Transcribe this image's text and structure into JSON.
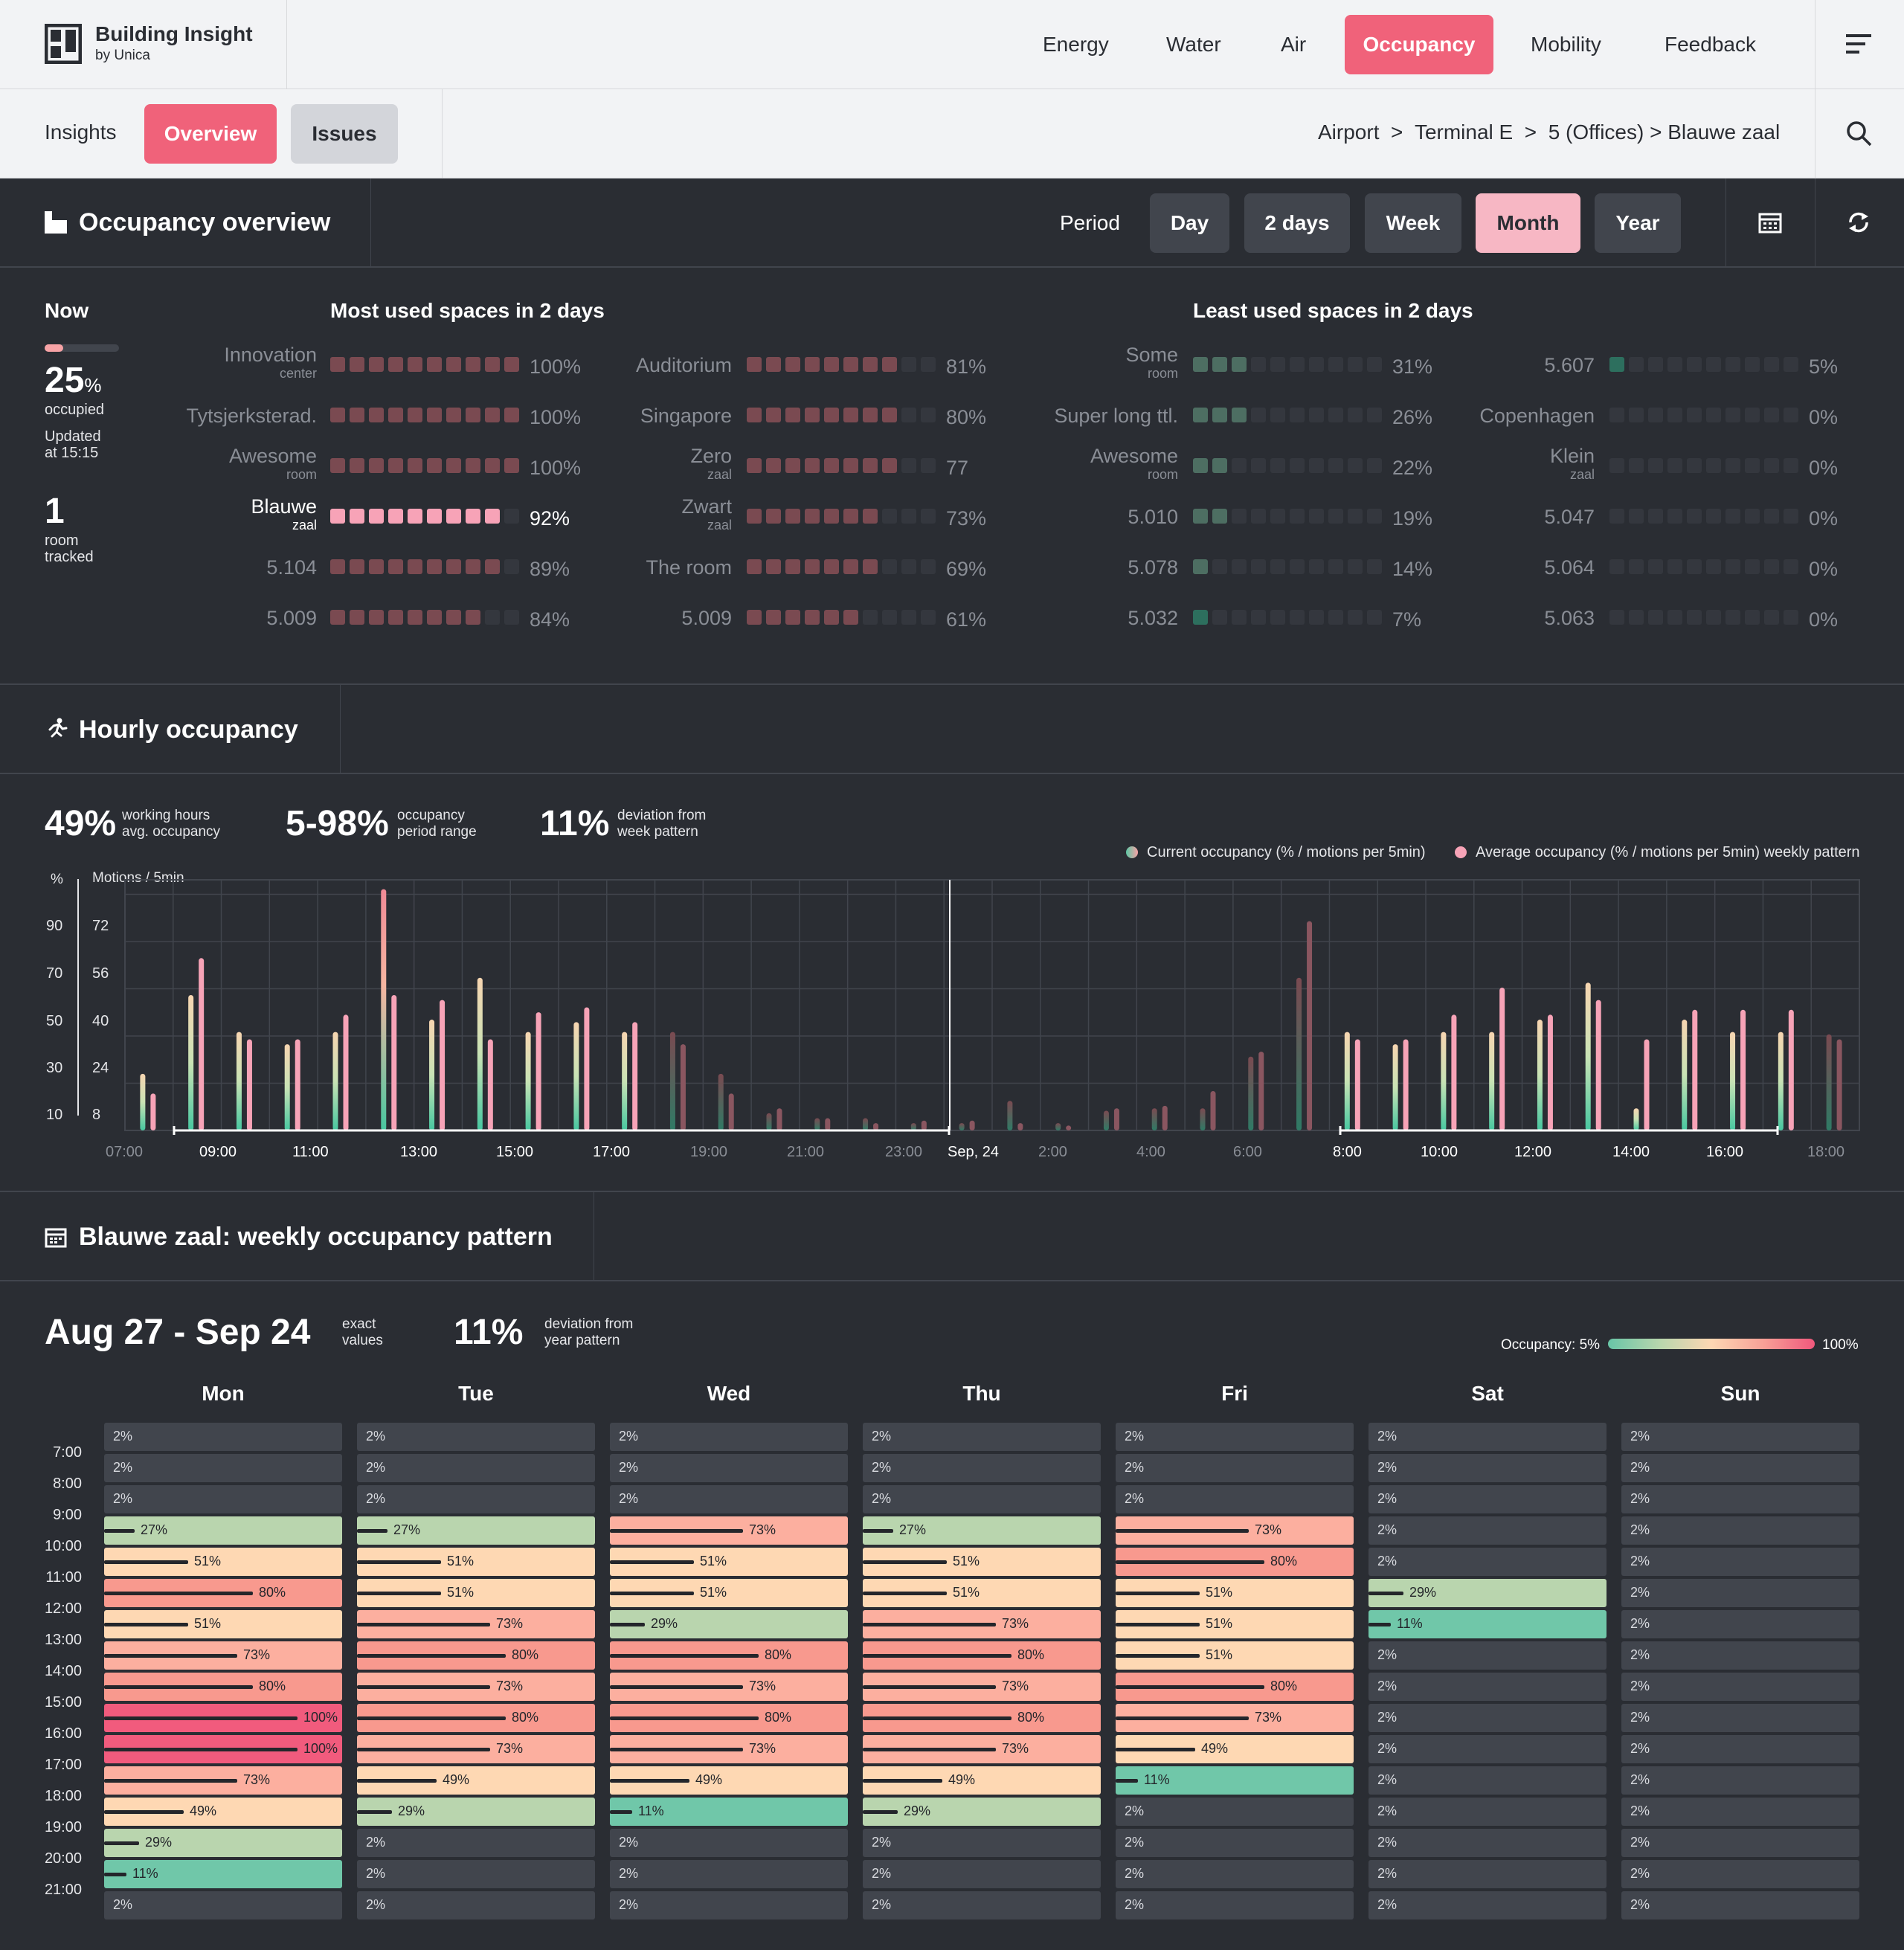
{
  "app": {
    "name": "Building Insight",
    "by": "by Unica"
  },
  "nav": {
    "items": [
      "Energy",
      "Water",
      "Air",
      "Occupancy",
      "Mobility",
      "Feedback"
    ],
    "active": "Occupancy"
  },
  "subnav": {
    "insights": "Insights",
    "overview": "Overview",
    "issues": "Issues"
  },
  "breadcrumb": {
    "l1": "Airport",
    "s1": ">",
    "l2": "Terminal E",
    "s2": ">",
    "l3": "5 (Offices)",
    "s3": ">",
    "l4": "Blauwe zaal"
  },
  "overview": {
    "title": "Occupancy overview",
    "period_label": "Period",
    "periods": [
      "Day",
      "2 days",
      "Week",
      "Month",
      "Year"
    ],
    "active_period": "Month",
    "now": {
      "label": "Now",
      "pct_num": "25",
      "pct_sign": "%",
      "occupied": "occupied",
      "updated": "Updated",
      "at": "at 15:15",
      "rooms": "1",
      "room": "room",
      "tracked": "tracked",
      "level": 0.25
    },
    "most_title": "Most used spaces in 2 days",
    "least_title": "Least used spaces in 2 days",
    "most_col1": [
      {
        "name": "Innovation",
        "sub": "center",
        "pct": "100%",
        "v": 100
      },
      {
        "name": "Tytsjerksterad.",
        "sub": "",
        "pct": "100%",
        "v": 100
      },
      {
        "name": "Awesome",
        "sub": "room",
        "pct": "100%",
        "v": 100
      },
      {
        "name": "Blauwe",
        "sub": "zaal",
        "pct": "92%",
        "v": 92,
        "hl": true
      },
      {
        "name": "5.104",
        "sub": "",
        "pct": "89%",
        "v": 89
      },
      {
        "name": "5.009",
        "sub": "",
        "pct": "84%",
        "v": 84
      }
    ],
    "most_col2": [
      {
        "name": "Auditorium",
        "sub": "",
        "pct": "81%",
        "v": 81
      },
      {
        "name": "Singapore",
        "sub": "",
        "pct": "80%",
        "v": 80
      },
      {
        "name": "Zero",
        "sub": "zaal",
        "pct": "77",
        "v": 77
      },
      {
        "name": "Zwart",
        "sub": "zaal",
        "pct": "73%",
        "v": 73
      },
      {
        "name": "The room",
        "sub": "",
        "pct": "69%",
        "v": 69
      },
      {
        "name": "5.009",
        "sub": "",
        "pct": "61%",
        "v": 61
      }
    ],
    "least_col1": [
      {
        "name": "Some",
        "sub": "room",
        "pct": "31%",
        "v": 31
      },
      {
        "name": "Super long ttl.",
        "sub": "",
        "pct": "26%",
        "v": 26
      },
      {
        "name": "Awesome",
        "sub": "room",
        "pct": "22%",
        "v": 22
      },
      {
        "name": "5.010",
        "sub": "",
        "pct": "19%",
        "v": 19
      },
      {
        "name": "5.078",
        "sub": "",
        "pct": "14%",
        "v": 14
      },
      {
        "name": "5.032",
        "sub": "",
        "pct": "7%",
        "v": 7
      }
    ],
    "least_col2": [
      {
        "name": "5.607",
        "sub": "",
        "pct": "5%",
        "v": 5
      },
      {
        "name": "Copenhagen",
        "sub": "",
        "pct": "0%",
        "v": 0
      },
      {
        "name": "Klein",
        "sub": "zaal",
        "pct": "0%",
        "v": 0
      },
      {
        "name": "5.047",
        "sub": "",
        "pct": "0%",
        "v": 0
      },
      {
        "name": "5.064",
        "sub": "",
        "pct": "0%",
        "v": 0
      },
      {
        "name": "5.063",
        "sub": "",
        "pct": "0%",
        "v": 0
      }
    ]
  },
  "hourly": {
    "title": "Hourly occupancy",
    "kpis": [
      {
        "value": "49%",
        "l1": "working hours",
        "l2": "avg. occupancy"
      },
      {
        "value": "5-98%",
        "l1": "occupancy",
        "l2": "period range"
      },
      {
        "value": "11%",
        "l1": "deviation from",
        "l2": "week pattern"
      }
    ],
    "legend_current": "Current occupancy (% / motions per 5min)",
    "legend_average": "Average occupancy (% / motions per 5min) weekly pattern",
    "y_unit": "%",
    "y2_unit": "Motions / 5min",
    "y_ticks": [
      "90",
      "70",
      "50",
      "30",
      "10"
    ],
    "y2_ticks": [
      "72",
      "56",
      "40",
      "24",
      "8"
    ],
    "x_ticks": [
      "07:00",
      "09:00",
      "11:00",
      "13:00",
      "15:00",
      "17:00",
      "19:00",
      "21:00",
      "23:00",
      "Sep, 24",
      "2:00",
      "4:00",
      "6:00",
      "8:00",
      "10:00",
      "12:00",
      "14:00",
      "16:00",
      "18:00"
    ],
    "colors": {
      "current": "#5cc7a5",
      "average": "#f7a3b7"
    }
  },
  "chart_data": {
    "type": "bar",
    "x_labels": [
      "07:00",
      "08:00",
      "09:00",
      "10:00",
      "11:00",
      "12:00",
      "13:00",
      "14:00",
      "15:00",
      "16:00",
      "17:00",
      "18:00",
      "19:00",
      "20:00",
      "21:00",
      "22:00",
      "23:00",
      "00:00",
      "01:00",
      "02:00",
      "03:00",
      "04:00",
      "05:00",
      "06:00",
      "07:00",
      "08:00",
      "09:00",
      "10:00",
      "11:00",
      "12:00",
      "13:00",
      "14:00",
      "15:00",
      "16:00",
      "17:00",
      "18:00"
    ],
    "series": [
      {
        "name": "Current occupancy (% / motions per 5min)",
        "values": [
          23,
          55,
          40,
          35,
          40,
          98,
          45,
          62,
          40,
          44,
          40,
          40,
          23,
          7,
          5,
          5,
          3,
          3,
          12,
          3,
          8,
          9,
          9,
          30,
          62,
          40,
          35,
          40,
          40,
          45,
          60,
          9,
          45,
          40,
          40,
          39
        ]
      },
      {
        "name": "Average occupancy (% / motions per 5min) weekly pattern",
        "values": [
          15,
          70,
          37,
          37,
          47,
          55,
          53,
          37,
          48,
          50,
          44,
          35,
          15,
          9,
          5,
          3,
          4,
          4,
          3,
          2,
          9,
          10,
          16,
          32,
          85,
          37,
          37,
          47,
          58,
          47,
          53,
          37,
          49,
          49,
          49,
          37
        ]
      }
    ],
    "y_label": "%",
    "y2_label": "Motions / 5min",
    "ylim": [
      0,
      100
    ]
  },
  "weekly": {
    "title": "Blauwe zaal: weekly occupancy pattern",
    "range": "Aug 27 - Sep 24",
    "exact1": "exact",
    "exact2": "values",
    "dev_value": "11%",
    "dev1": "deviation from",
    "dev2": "year pattern",
    "scale_label": "Occupancy: 5%",
    "scale_max": "100%",
    "days": [
      "Mon",
      "Tue",
      "Wed",
      "Thu",
      "Fri",
      "Sat",
      "Sun"
    ],
    "hours": [
      "7:00",
      "8:00",
      "9:00",
      "10:00",
      "11:00",
      "12:00",
      "13:00",
      "14:00",
      "15:00",
      "16:00",
      "17:00",
      "18:00",
      "19:00",
      "20:00",
      "21:00"
    ],
    "grid": [
      [
        2,
        2,
        2,
        27,
        51,
        80,
        51,
        73,
        80,
        100,
        100,
        73,
        49,
        29,
        11,
        2
      ],
      [
        2,
        2,
        2,
        27,
        51,
        51,
        73,
        80,
        73,
        80,
        73,
        49,
        29,
        2,
        2,
        2
      ],
      [
        2,
        2,
        2,
        73,
        51,
        51,
        29,
        80,
        73,
        80,
        73,
        49,
        11,
        2,
        2,
        2
      ],
      [
        2,
        2,
        2,
        27,
        51,
        51,
        73,
        80,
        73,
        80,
        73,
        49,
        29,
        2,
        2,
        2
      ],
      [
        2,
        2,
        2,
        73,
        80,
        51,
        51,
        51,
        80,
        73,
        49,
        11,
        2,
        2,
        2,
        2
      ],
      [
        2,
        2,
        2,
        2,
        2,
        29,
        11,
        2,
        2,
        2,
        2,
        2,
        2,
        2,
        2,
        2
      ],
      [
        2,
        2,
        2,
        2,
        2,
        2,
        2,
        2,
        2,
        2,
        2,
        2,
        2,
        2,
        2,
        2
      ]
    ]
  }
}
